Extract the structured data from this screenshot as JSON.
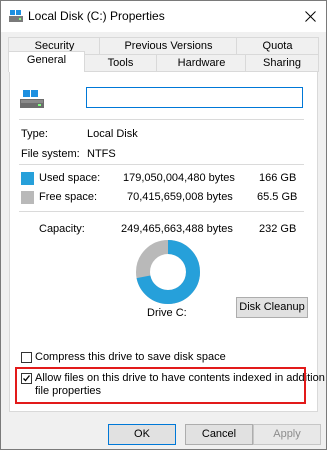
{
  "window": {
    "title": "Local Disk (C:) Properties"
  },
  "tabs": {
    "row1": [
      "Security",
      "Previous Versions",
      "Quota"
    ],
    "row2": [
      "General",
      "Tools",
      "Hardware",
      "Sharing"
    ]
  },
  "general": {
    "type_label": "Type:",
    "type_value": "Local Disk",
    "fs_label": "File system:",
    "fs_value": "NTFS",
    "used_label": "Used space:",
    "used_bytes": "179,050,004,480 bytes",
    "used_gb": "166 GB",
    "free_label": "Free space:",
    "free_bytes": "70,415,659,008 bytes",
    "free_gb": "65.5 GB",
    "capacity_label": "Capacity:",
    "capacity_bytes": "249,465,663,488 bytes",
    "capacity_gb": "232 GB",
    "drive_label": "Drive C:",
    "disk_cleanup": "Disk Cleanup",
    "compress_label": "Compress this drive to save disk space",
    "index_label_line1": "Allow files on this drive to have contents indexed in addition to",
    "index_label_line2": "file properties",
    "used_fraction": 0.718,
    "colors": {
      "used": "#26a0da",
      "free": "#b9b9b9",
      "highlight": "#e21a1a"
    }
  },
  "buttons": {
    "ok": "OK",
    "cancel": "Cancel",
    "apply": "Apply"
  }
}
